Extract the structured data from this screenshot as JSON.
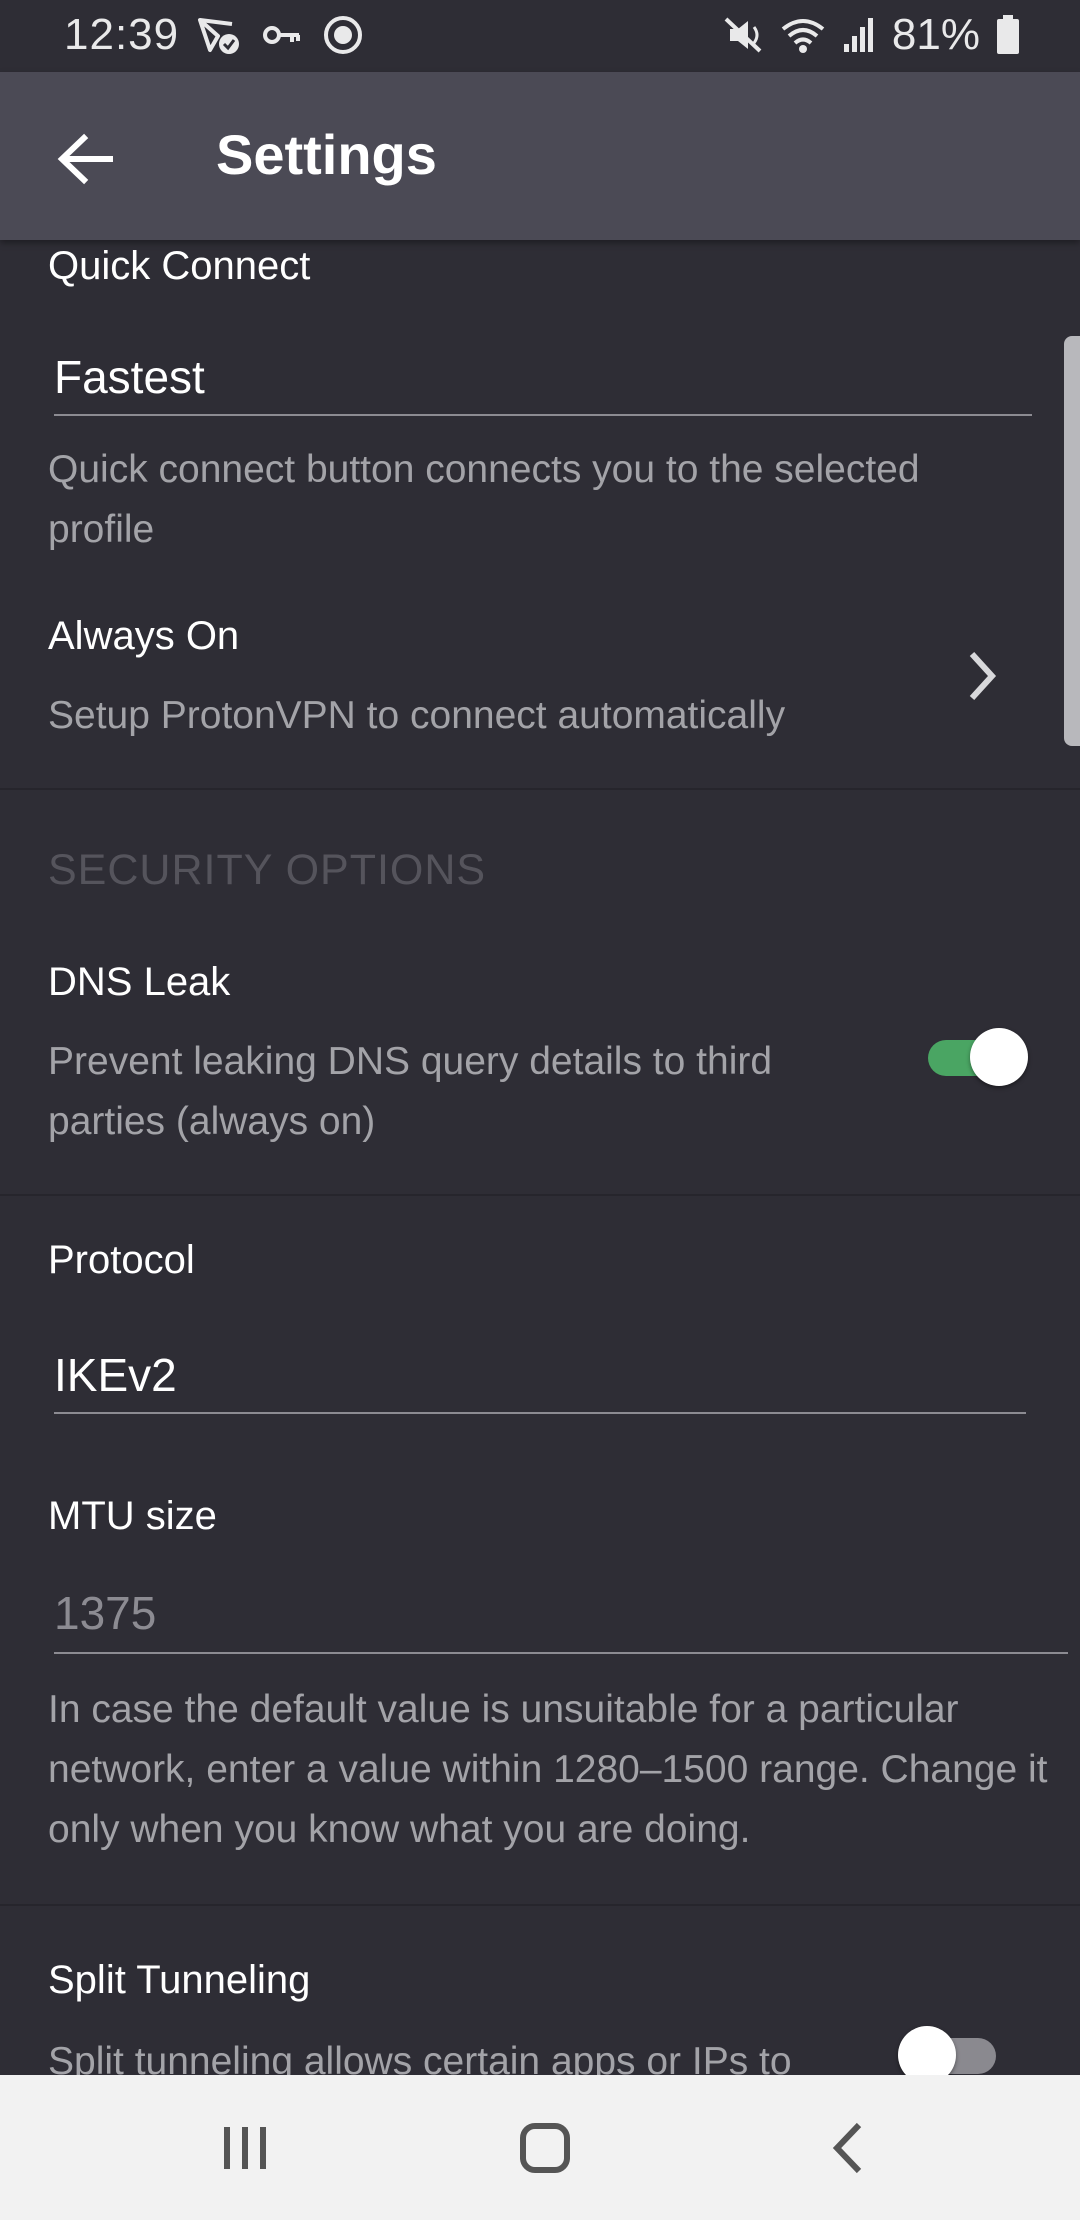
{
  "status_bar": {
    "time": "12:39",
    "battery_percent": "81%",
    "icons_left": [
      "vpn-check-icon",
      "key-icon",
      "record-icon"
    ],
    "icons_right": [
      "mute-icon",
      "wifi-icon",
      "signal-icon",
      "battery-icon"
    ]
  },
  "app_bar": {
    "title": "Settings",
    "back_icon": "arrow-left-icon"
  },
  "quick_connect": {
    "label": "Quick Connect",
    "value": "Fastest",
    "description": "Quick connect button connects you to the selected profile"
  },
  "always_on": {
    "label": "Always On",
    "description": "Setup ProtonVPN to connect automatically"
  },
  "security_section": {
    "header": "SECURITY OPTIONS"
  },
  "dns_leak": {
    "label": "DNS Leak",
    "description": "Prevent leaking DNS query details to third parties (always on)",
    "enabled": true
  },
  "protocol": {
    "label": "Protocol",
    "value": "IKEv2"
  },
  "mtu": {
    "label": "MTU size",
    "placeholder": "1375",
    "description": "In case the default value is unsuitable for a particular network, enter a value within 1280–1500 range. Change it only when you know what you are doing."
  },
  "split_tunneling": {
    "label": "Split Tunneling",
    "description": "Split tunneling allows certain apps or IPs to",
    "enabled": false
  },
  "colors": {
    "background": "#2e2d35",
    "app_bar": "#4b4a55",
    "toggle_on": "#4aa563",
    "secondary_text": "#a3a3a8"
  },
  "nav_bar": {
    "recents_icon": "recents-icon",
    "home_icon": "home-icon",
    "back_icon": "back-chevron-icon"
  }
}
